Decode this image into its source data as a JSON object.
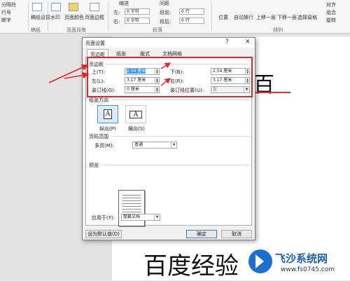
{
  "ribbon": {
    "left_items": [
      "分隔符",
      "行号",
      "断字"
    ],
    "watermark_group_label": "稿纸",
    "buttons": [
      "稿纸设置",
      "水印",
      "页面颜色",
      "页面边框"
    ],
    "background_group_label": "页面背景",
    "indent_header": "缩进",
    "spacing_header": "间距",
    "indent_left_label": "左:",
    "indent_left_value": "0 字符",
    "indent_right_label": "右:",
    "indent_right_value": "0 字符",
    "space_before_label": "段前:",
    "space_before_value": "0 行",
    "space_after_label": "段后:",
    "space_after_value": "0 行",
    "paragraph_group_label": "段落",
    "arrange_buttons": [
      "位置",
      "自动换行",
      "上移一层",
      "下移一层",
      "选择窗格"
    ],
    "arrange_right_items": [
      "对齐",
      "组合",
      "旋转"
    ],
    "arrange_group_label": "排列"
  },
  "document": {
    "big_char": "百",
    "bottom_text": "百度经验"
  },
  "watermark": {
    "title": "飞沙系统网",
    "url": "www.fs0745.com"
  },
  "dialog": {
    "title": "页面设置",
    "help_button": "?",
    "close_button": "✕",
    "tabs": [
      "页边距",
      "纸张",
      "版式",
      "文档网格"
    ],
    "margins_section": "页边距",
    "top_label": "上(T):",
    "top_value": "2.54 厘米",
    "bottom_label": "下(B):",
    "bottom_value": "2.54 厘米",
    "left_label": "左(L):",
    "left_value": "3.17 厘米",
    "right_label": "右(R):",
    "right_value": "3.17 厘米",
    "gutter_label": "装订线(G):",
    "gutter_value": "0 厘米",
    "gutter_pos_label": "装订线位置(U):",
    "gutter_pos_value": "左",
    "orientation_section": "纸张方向",
    "portrait_label": "纵向(P)",
    "landscape_label": "横向(S)",
    "pages_section": "页码范围",
    "multiple_pages_label": "多页(M):",
    "multiple_pages_value": "普通",
    "preview_section": "预览",
    "apply_to_label": "应用于(Y):",
    "apply_to_value": "整篇文档",
    "default_button": "设为默认值(D)",
    "ok_button": "确定",
    "cancel_button": "取消"
  }
}
